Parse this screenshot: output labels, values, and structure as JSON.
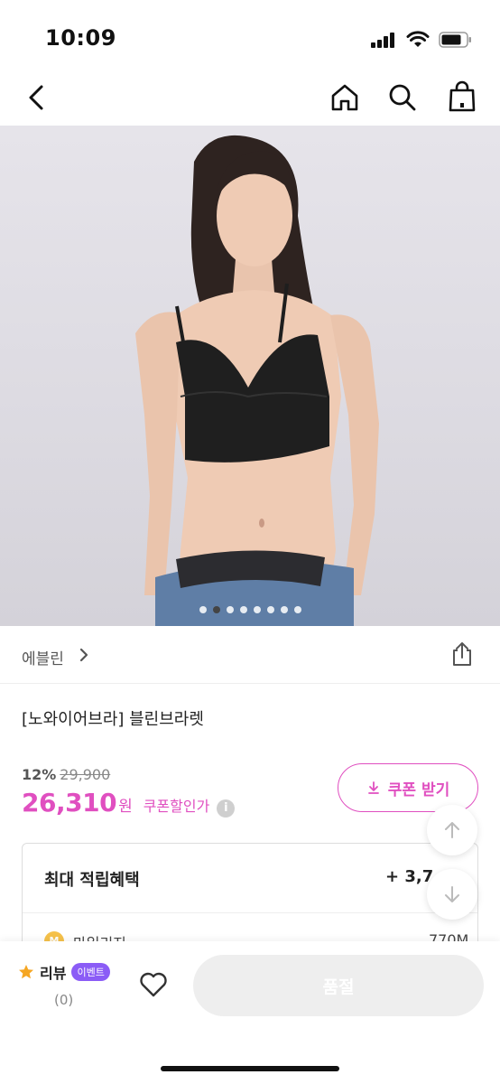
{
  "status_bar": {
    "time": "10:09"
  },
  "nav": {
    "back_icon": "chevron-left-icon",
    "home_icon": "home-icon",
    "search_icon": "search-icon",
    "bag_icon": "shopping-bag-icon"
  },
  "gallery": {
    "image_count": 8,
    "active_index": 1
  },
  "brand": {
    "name": "에블린",
    "share_icon": "share-icon"
  },
  "product": {
    "title": "[노와이어브라] 블린브라렛"
  },
  "pricing": {
    "discount_percent": "12%",
    "original_price": "29,900",
    "sale_price": "26,310",
    "currency": "원",
    "coupon_note": "쿠폰할인가",
    "info_icon": "i",
    "coupon_button": "쿠폰 받기"
  },
  "benefits": {
    "title": "최대 적립혜택",
    "total": "+ 3,7",
    "mileage_icon_text": "M",
    "mileage_label": "마일리지",
    "mileage_value": "770M"
  },
  "bottom_bar": {
    "review_label": "리뷰",
    "event_badge": "이벤트",
    "review_count": "(0)",
    "sold_out": "품절"
  },
  "colors": {
    "accent": "#e04fc0",
    "event_badge": "#8b5cf6",
    "disabled_button": "#eeeeee"
  }
}
